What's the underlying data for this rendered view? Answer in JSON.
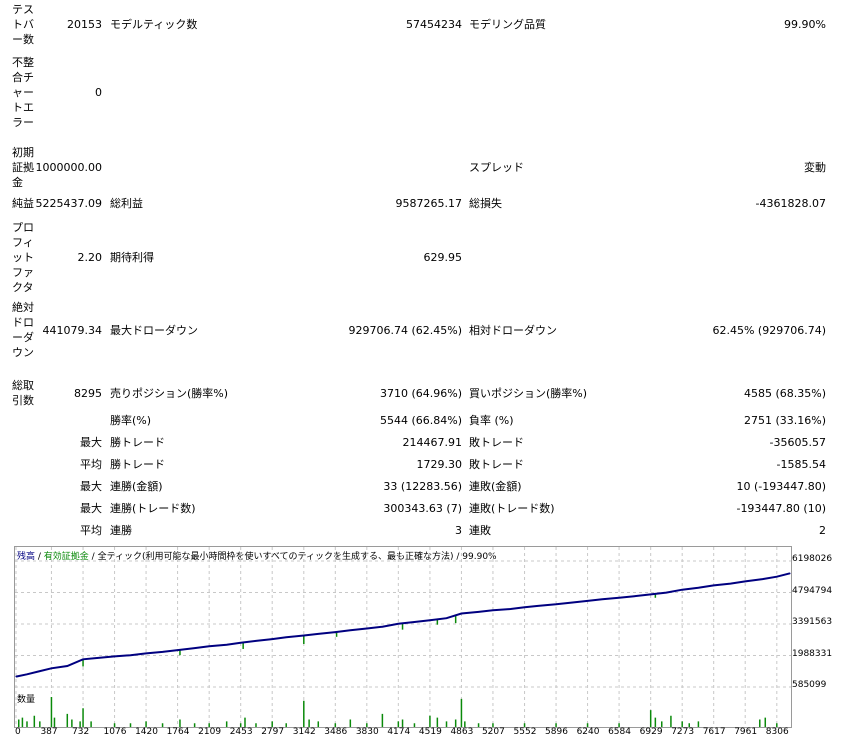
{
  "report": {
    "rows": [
      {
        "l1": "テストバー数",
        "v1": "20153",
        "l2": "モデルティック数",
        "v2": "57454234",
        "l3": "モデリング品質",
        "v3": "99.90%"
      },
      {
        "l1": "不整合チャートエラー",
        "v1": "0"
      },
      {
        "l1": "初期証拠金",
        "v1": "1000000.00",
        "l3": "スプレッド",
        "v3": "変動"
      },
      {
        "l1": "純益",
        "v1": "5225437.09",
        "l2": "総利益",
        "v2": "9587265.17",
        "l3": "総損失",
        "v3": "-4361828.07"
      },
      {
        "l1": "プロフィットファクタ",
        "v1": "2.20",
        "l2": "期待利得",
        "v2": "629.95"
      },
      {
        "l1": "絶対ドローダウン",
        "v1": "441079.34",
        "l2": "最大ドローダウン",
        "v2": "929706.74 (62.45%)",
        "l3": "相対ドローダウン",
        "v3": "62.45% (929706.74)"
      },
      {
        "l1": "総取引数",
        "v1": "8295",
        "l2": "売りポジション(勝率%)",
        "v2": "3710 (64.96%)",
        "l3": "買いポジション(勝率%)",
        "v3": "4585 (68.35%)"
      },
      {
        "p": "",
        "l2": "勝率(%)",
        "v2": "5544 (66.84%)",
        "l3": "負率 (%)",
        "v3": "2751 (33.16%)"
      },
      {
        "p": "最大",
        "l2": "勝トレード",
        "v2": "214467.91",
        "l3": "敗トレード",
        "v3": "-35605.57"
      },
      {
        "p": "平均",
        "l2": "勝トレード",
        "v2": "1729.30",
        "l3": "敗トレード",
        "v3": "-1585.54"
      },
      {
        "p": "最大",
        "l2": "連勝(金額)",
        "v2": "33 (12283.56)",
        "l3": "連敗(金額)",
        "v3": "10 (-193447.80)"
      },
      {
        "p": "最大",
        "l2": "連勝(トレード数)",
        "v2": "300343.63 (7)",
        "l3": "連敗(トレード数)",
        "v3": "-193447.80 (10)"
      },
      {
        "p": "平均",
        "l2": "連勝",
        "v2": "3",
        "l3": "連敗",
        "v3": "2"
      }
    ]
  },
  "chart": {
    "legend": {
      "balance": "残高",
      "sep1": " / ",
      "equity": "有効証拠金",
      "sep2": " / ",
      "model": "全ティック(利用可能な最小時間枠を使いすべてのティックを生成する、最も正確な方法)",
      "sep3": " / ",
      "quality": "99.90%"
    },
    "volume_label": "数量",
    "colors": {
      "balance": "#000080",
      "equity": "#0a8a0a",
      "grid": "#c8c8c8"
    }
  },
  "chart_data": {
    "type": "line",
    "title": "",
    "y_ticks": [
      "6198026",
      "4794794",
      "3391563",
      "1988331",
      "585099"
    ],
    "ylim": [
      585099,
      6198026
    ],
    "x_ticks": [
      "0",
      "387",
      "732",
      "1076",
      "1420",
      "1764",
      "2109",
      "2453",
      "2797",
      "3142",
      "3486",
      "3830",
      "4174",
      "4519",
      "4863",
      "5207",
      "5552",
      "5896",
      "6240",
      "6584",
      "6929",
      "7273",
      "7617",
      "7961",
      "8306"
    ],
    "xlim": [
      0,
      8450
    ],
    "series": [
      {
        "x": [
          0,
          120,
          250,
          387,
          560,
          732,
          900,
          1076,
          1250,
          1420,
          1600,
          1764,
          1950,
          2109,
          2300,
          2453,
          2620,
          2797,
          2950,
          3142,
          3300,
          3486,
          3650,
          3830,
          4000,
          4174,
          4350,
          4519,
          4700,
          4863,
          5050,
          5207,
          5400,
          5552,
          5700,
          5896,
          6050,
          6240,
          6400,
          6584,
          6750,
          6929,
          7100,
          7273,
          7450,
          7617,
          7800,
          7961,
          8150,
          8306,
          8450
        ],
        "y": [
          1050000,
          1150000,
          1280000,
          1420000,
          1520000,
          1820000,
          1880000,
          1950000,
          2000000,
          2080000,
          2150000,
          2230000,
          2320000,
          2400000,
          2470000,
          2560000,
          2640000,
          2720000,
          2800000,
          2880000,
          2950000,
          3030000,
          3110000,
          3190000,
          3270000,
          3400000,
          3480000,
          3560000,
          3650000,
          3860000,
          3930000,
          4000000,
          4060000,
          4140000,
          4200000,
          4270000,
          4340000,
          4420000,
          4490000,
          4560000,
          4630000,
          4710000,
          4790000,
          4920000,
          5010000,
          5110000,
          5190000,
          5290000,
          5390000,
          5500000,
          5650000
        ]
      }
    ],
    "equity_dips": [
      {
        "x": 732,
        "y": 1500000
      },
      {
        "x": 1790,
        "y": 2000000
      },
      {
        "x": 2480,
        "y": 2280000
      },
      {
        "x": 3142,
        "y": 2500000
      },
      {
        "x": 3500,
        "y": 2820000
      },
      {
        "x": 4220,
        "y": 3140000
      },
      {
        "x": 4600,
        "y": 3360000
      },
      {
        "x": 4800,
        "y": 3430000
      },
      {
        "x": 6980,
        "y": 4560000
      },
      {
        "x": 8120,
        "y": 5350000
      }
    ],
    "volume": {
      "x": [
        30,
        70,
        120,
        200,
        260,
        387,
        420,
        560,
        610,
        700,
        732,
        820,
        1076,
        1250,
        1420,
        1600,
        1790,
        1950,
        2109,
        2300,
        2453,
        2500,
        2620,
        2797,
        2950,
        3142,
        3200,
        3300,
        3486,
        3650,
        3830,
        4000,
        4174,
        4220,
        4350,
        4519,
        4600,
        4700,
        4800,
        4863,
        4900,
        5050,
        5207,
        5552,
        5896,
        6240,
        6584,
        6929,
        6980,
        7050,
        7150,
        7273,
        7350,
        7450,
        8120,
        8180,
        8306
      ],
      "v": [
        4,
        5,
        3,
        6,
        3,
        16,
        5,
        7,
        4,
        3,
        10,
        3,
        2,
        2,
        3,
        2,
        4,
        2,
        2,
        3,
        2,
        5,
        2,
        3,
        2,
        14,
        4,
        3,
        2,
        4,
        2,
        7,
        3,
        4,
        2,
        6,
        5,
        3,
        4,
        15,
        3,
        2,
        2,
        2,
        2,
        2,
        2,
        9,
        5,
        3,
        6,
        3,
        2,
        3,
        4,
        5,
        2
      ]
    }
  }
}
